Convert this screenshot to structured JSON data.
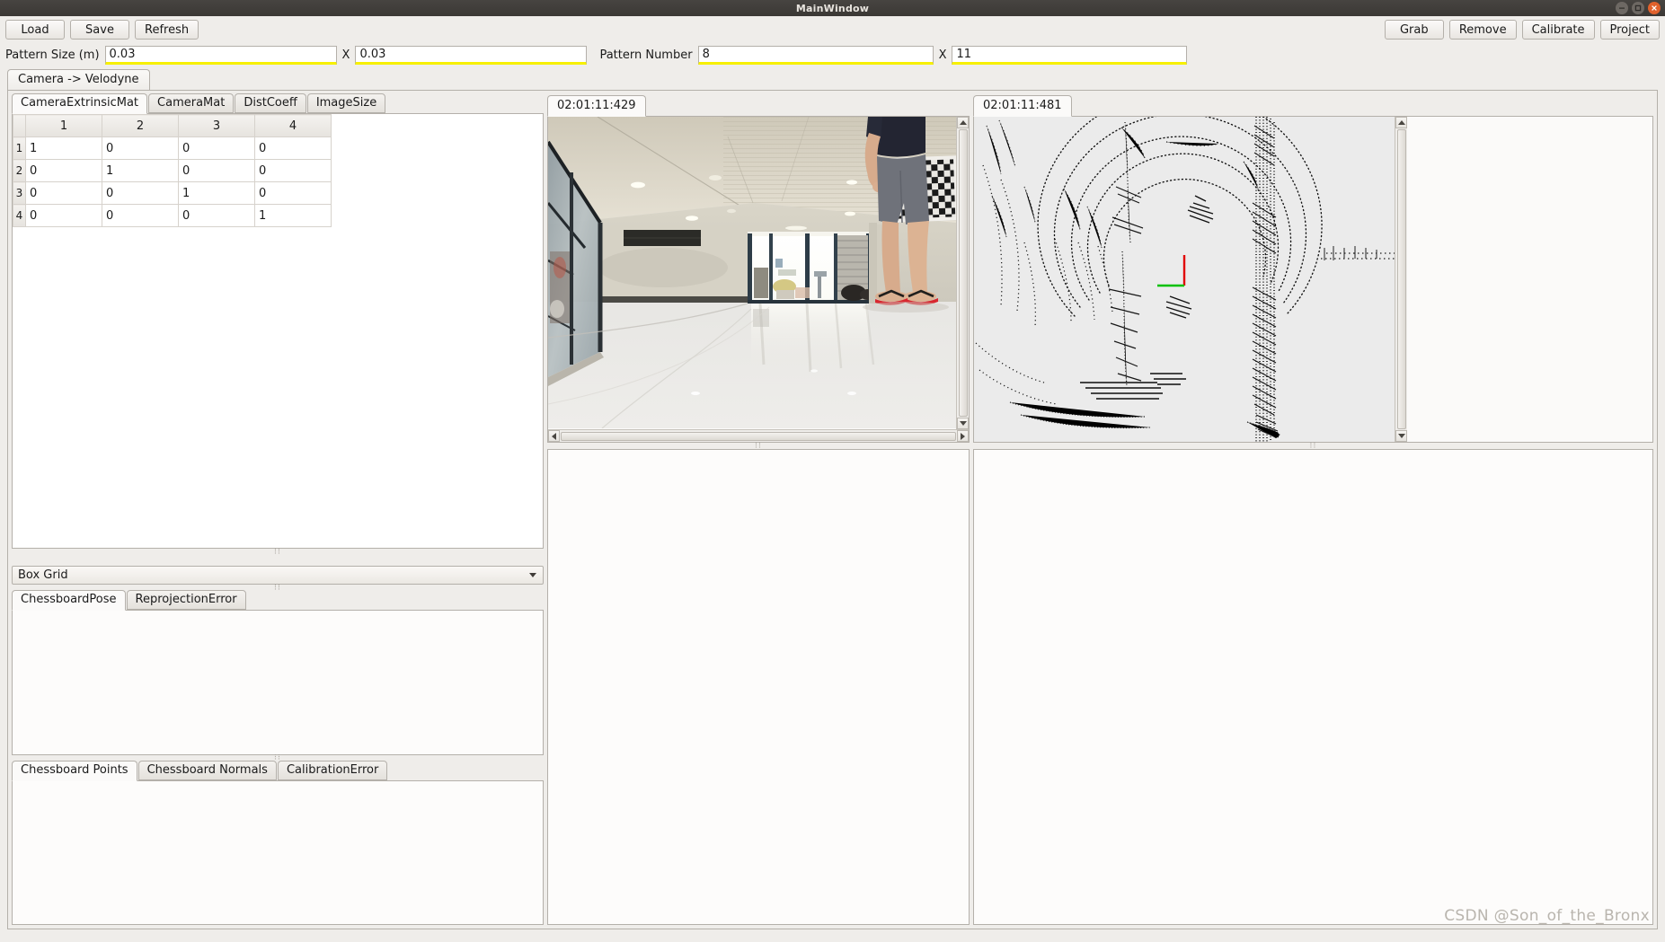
{
  "window": {
    "title": "MainWindow",
    "controls": [
      {
        "name": "minimize",
        "icon": "minimize-icon",
        "color": "#6d6863"
      },
      {
        "name": "maximize",
        "icon": "maximize-icon",
        "color": "#6d6863"
      },
      {
        "name": "close",
        "icon": "close-icon",
        "color": "#e0612c"
      }
    ]
  },
  "toolbar": {
    "left_buttons": [
      {
        "label": "Load"
      },
      {
        "label": "Save"
      },
      {
        "label": "Refresh"
      }
    ],
    "right_buttons": [
      {
        "label": "Grab"
      },
      {
        "label": "Remove"
      },
      {
        "label": "Calibrate"
      },
      {
        "label": "Project"
      }
    ]
  },
  "params": {
    "pattern_size_label": "Pattern Size (m)",
    "pattern_size_x": "0.03",
    "pattern_size_y": "0.03",
    "separator": "X",
    "pattern_number_label": "Pattern Number",
    "pattern_number_x": "8",
    "pattern_number_y": "11",
    "highlight_color": "#f7f000"
  },
  "outer_tabs": [
    {
      "label": "Camera -> Velodyne",
      "selected": true
    }
  ],
  "matrix_tabs": [
    {
      "label": "CameraExtrinsicMat",
      "selected": true
    },
    {
      "label": "CameraMat",
      "selected": false
    },
    {
      "label": "DistCoeff",
      "selected": false
    },
    {
      "label": "ImageSize",
      "selected": false
    }
  ],
  "matrix_table": {
    "columns": [
      "1",
      "2",
      "3",
      "4"
    ],
    "rows": [
      {
        "header": "1",
        "cells": [
          "1",
          "0",
          "0",
          "0"
        ]
      },
      {
        "header": "2",
        "cells": [
          "0",
          "1",
          "0",
          "0"
        ]
      },
      {
        "header": "3",
        "cells": [
          "0",
          "0",
          "1",
          "0"
        ]
      },
      {
        "header": "4",
        "cells": [
          "0",
          "0",
          "0",
          "1"
        ]
      }
    ]
  },
  "combo": {
    "selected": "Box Grid",
    "options": [
      "Box Grid"
    ],
    "icon": "chevron-down-icon"
  },
  "pose_tabs": [
    {
      "label": "ChessboardPose",
      "selected": true
    },
    {
      "label": "ReprojectionError",
      "selected": false
    }
  ],
  "points_tabs": [
    {
      "label": "Chessboard Points",
      "selected": true
    },
    {
      "label": "Chessboard Normals",
      "selected": false
    },
    {
      "label": "CalibrationError",
      "selected": false
    }
  ],
  "camera_view": {
    "tab_label": "02:01:11:429",
    "scrollbars": {
      "vertical": true,
      "horizontal": true
    }
  },
  "lidar_view": {
    "tab_label": "02:01:11:481",
    "axis_colors": {
      "x": "#00c000",
      "z": "#e00000"
    }
  },
  "watermark": "CSDN @Son_of_the_Bronx"
}
